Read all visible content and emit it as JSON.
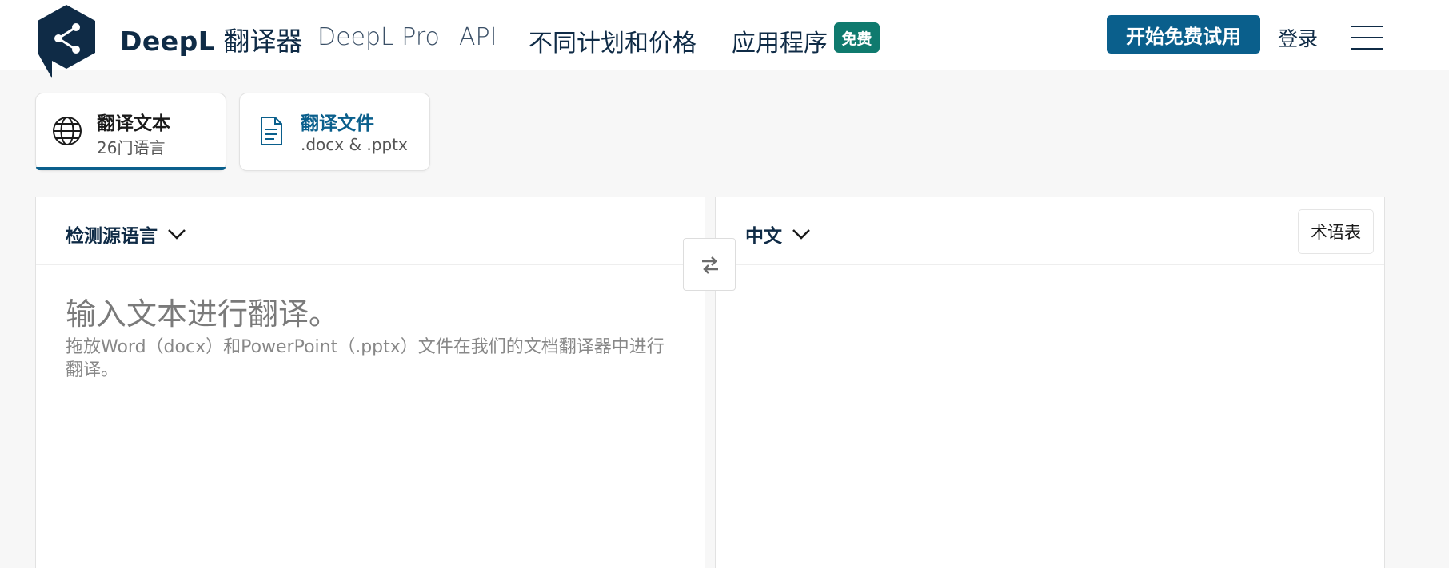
{
  "header": {
    "brand_name": "DeepL",
    "brand_product": "翻译器",
    "nav": [
      "DeepL Pro",
      "API",
      "不同计划和价格",
      "应用程序"
    ],
    "free_badge": "免费",
    "cta": "开始免费试用",
    "login": "登录",
    "logo_icon": "deepl-share-icon",
    "menu_icon": "hamburger-icon"
  },
  "mode_tabs": [
    {
      "title": "翻译文本",
      "subtitle": "26门语言",
      "icon": "globe-icon",
      "active": true
    },
    {
      "title": "翻译文件",
      "subtitle": ".docx & .pptx",
      "icon": "document-icon",
      "active": false
    }
  ],
  "source": {
    "language": "检测源语言",
    "placeholder": "输入文本进行翻译。",
    "hint": "拖放Word（docx）和PowerPoint（.pptx）文件在我们的文档翻译器中进行翻译。"
  },
  "target": {
    "language": "中文",
    "glossary": "术语表"
  },
  "colors": {
    "brand_navy": "#0f2b46",
    "accent_blue": "#0a5f8c",
    "badge_green": "#0f7a6e",
    "background": "#f7f7f7"
  }
}
